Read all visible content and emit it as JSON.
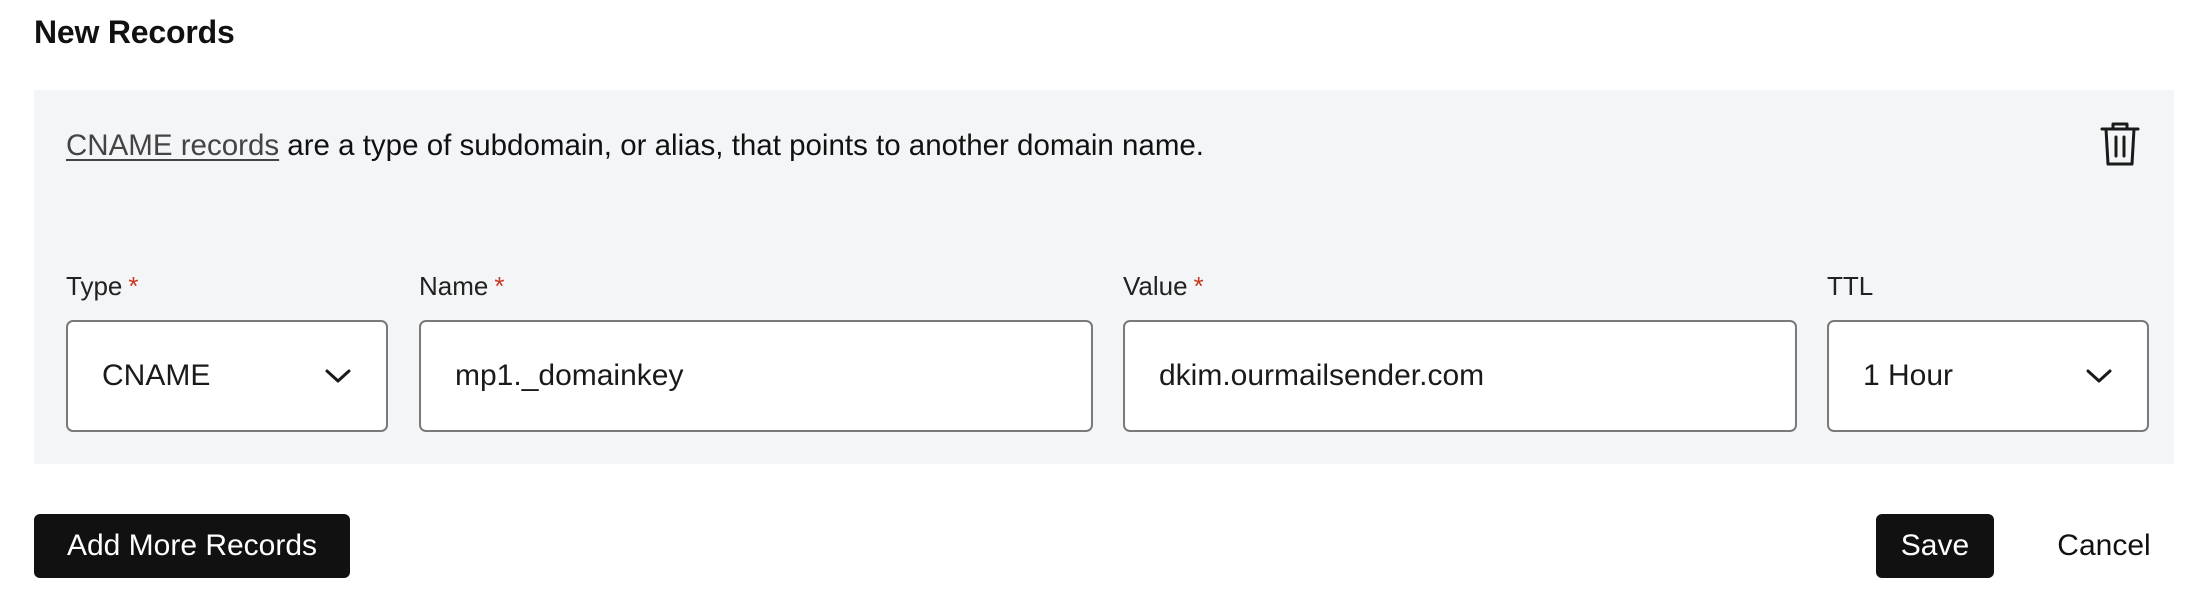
{
  "section": {
    "title": "New Records"
  },
  "record": {
    "description_link": "CNAME records",
    "description_text": " are a type of subdomain, or alias, that points to another domain name.",
    "delete_icon": "trash-icon",
    "fields": {
      "type": {
        "label": "Type",
        "required_mark": "*",
        "value": "CNAME",
        "icon": "chevron-down-icon"
      },
      "name": {
        "label": "Name",
        "required_mark": "*",
        "value": "mp1._domainkey"
      },
      "value": {
        "label": "Value",
        "required_mark": "*",
        "value": "dkim.ourmailsender.com"
      },
      "ttl": {
        "label": "TTL",
        "value": "1 Hour",
        "icon": "chevron-down-icon"
      }
    }
  },
  "actions": {
    "add_more": "Add More Records",
    "save": "Save",
    "cancel": "Cancel"
  },
  "colors": {
    "panel_bg": "#f4f5f7",
    "button_dark": "#111111",
    "required": "#c7371f",
    "border": "#7a7a7a"
  }
}
